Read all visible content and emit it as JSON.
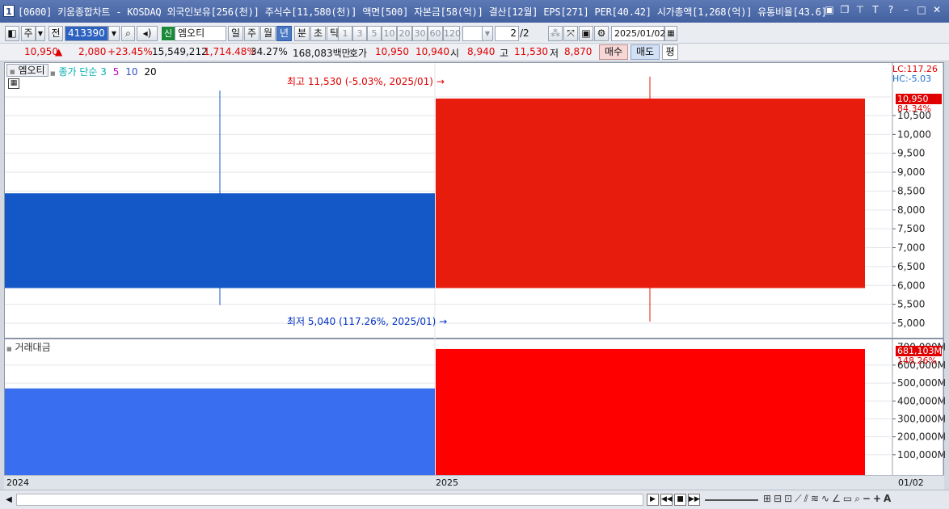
{
  "window": {
    "number": "1",
    "title": "[0600] 키움종합차트 - KOSDAQ 외국인보유[256(천)] 주식수[11,580(천)] 액면[500] 자본금[58(억)] 결산[12월] EPS[271] PER[40.42] 시가총액[1,268(억)] 유통비율[43.6]"
  },
  "toolbar": {
    "mode1": "주",
    "mode2": "전",
    "code": "413390",
    "badge": "신",
    "stock_name": "엠오티",
    "periods": [
      "일",
      "주",
      "월",
      "년",
      "분",
      "초",
      "틱"
    ],
    "active_period": "년",
    "numbers": [
      "1",
      "3",
      "5",
      "10",
      "20",
      "30",
      "60",
      "120"
    ],
    "page": "2",
    "page_total": "/2",
    "date": "2025/01/02"
  },
  "info": {
    "price": "10,950",
    "arrow": "▲",
    "change": "2,080",
    "change_pct": "+23.45%",
    "volume": "15,549,212",
    "vol_pct": "1,714.48%",
    "turnover": "34.27%",
    "amount": "168,083백만",
    "quote_label": "호가",
    "quote1": "10,950",
    "quote2": "10,940",
    "open_label": "시",
    "open": "8,940",
    "high_label": "고",
    "high": "11,530",
    "low_label": "저",
    "low": "8,870",
    "buy": "매수",
    "sell": "매도",
    "eval": "평"
  },
  "legend": {
    "name": "엠오티",
    "ma_label": "종가 단순",
    "ma": [
      "3",
      "5",
      "10",
      "20"
    ],
    "ma_colors": [
      "#00b0b0",
      "#c000c0",
      "#3050c0",
      "#000000"
    ]
  },
  "annotations": {
    "high": "최고 11,530 (-5.03%, 2025/01)",
    "low": "최저 5,040 (117.26%, 2025/01)",
    "lc": "LC:117.26",
    "hc": "HC:-5.03",
    "price_tag": "10,950",
    "price_pct": "84.34%",
    "vol_label": "거래대금",
    "vol_tag": "681,103M",
    "vol_pct": "148.26%"
  },
  "price_axis": {
    "ticks": [
      "10,500",
      "10,000",
      "9,500",
      "9,000",
      "8,500",
      "8,000",
      "7,500",
      "7,000",
      "6,500",
      "6,000",
      "5,500",
      "5,000"
    ],
    "min": 4800,
    "max": 11800
  },
  "volume_axis": {
    "ticks": [
      "600,000M",
      "500,000M",
      "400,000M",
      "300,000M",
      "200,000M",
      "100,000M"
    ],
    "top_tick": "700,000M",
    "max": 730000
  },
  "x_labels": [
    "2024",
    "2025"
  ],
  "x_last": "01/02",
  "candles": [
    {
      "period": "2024",
      "open": 8440,
      "close": 5930,
      "high": 11160,
      "low": 5480,
      "color": "#1458c8"
    },
    {
      "period": "2025",
      "open": 5930,
      "close": 10950,
      "high": 11530,
      "low": 5040,
      "color": "#e81c0c"
    }
  ],
  "volumes": [
    {
      "period": "2024",
      "value": 470000,
      "color": "#3a6ef0"
    },
    {
      "period": "2025",
      "value": 690000,
      "color": "#ff0000"
    }
  ]
}
